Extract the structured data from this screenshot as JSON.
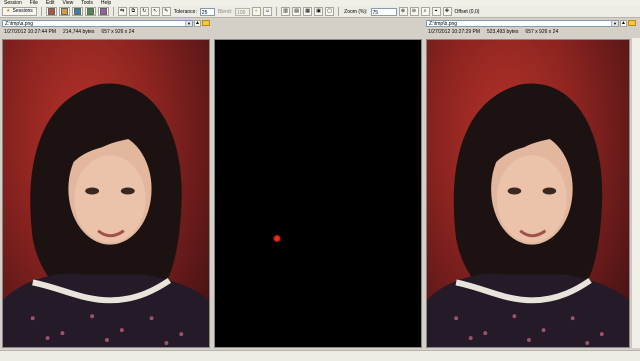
{
  "menu": [
    "Session",
    "File",
    "Edit",
    "View",
    "Tools",
    "Help"
  ],
  "toolbar": {
    "sessions_label": "Sessions",
    "tolerance_label": "Tolerance:",
    "tolerance_value": "25",
    "blend_label": "Blend:",
    "blend_value": "100",
    "zoom_label": "Zoom (%):",
    "zoom_value": "75",
    "offset_label": "Offset (0,0)"
  },
  "left": {
    "path": "Z:\\tmp\\a.png",
    "date": "1/27/2012 10:27:44 PM",
    "size": "214,744 bytes",
    "dims": "657 x 926 x 24"
  },
  "right": {
    "path": "Z:\\tmp\\b.png",
    "date": "1/27/2012 10:27:29 PM",
    "size": "523,493 bytes",
    "dims": "657 x 926 x 24"
  },
  "colors": {
    "diff_pixel": "#e02010",
    "backdrop": "#8d2420"
  }
}
